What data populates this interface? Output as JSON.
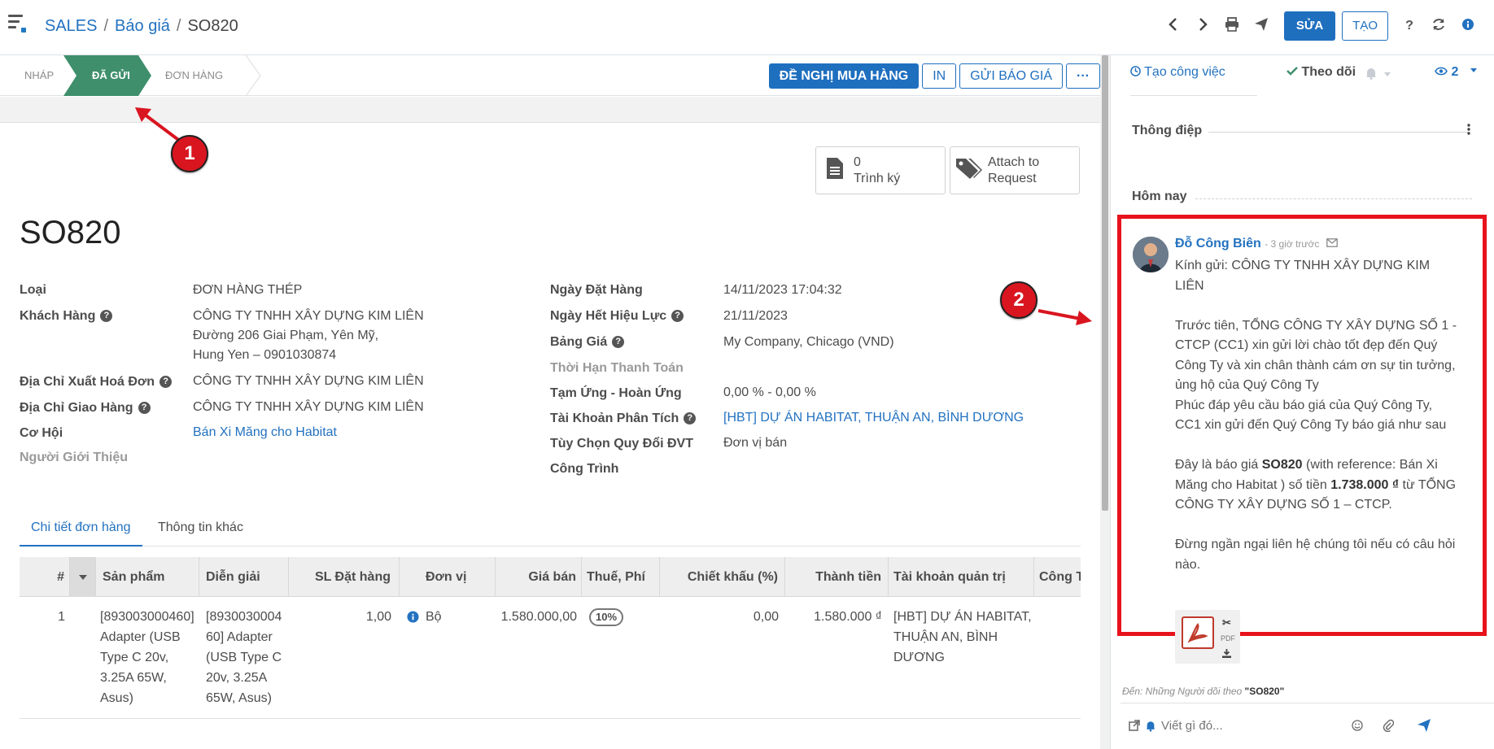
{
  "breadcrumb": {
    "root": "SALES",
    "section": "Báo giá",
    "record": "SO820"
  },
  "toolbar": {
    "edit_label": "SỬA",
    "create_label": "TẠO"
  },
  "status": {
    "stages": [
      "NHÁP",
      "ĐÃ GỬI",
      "ĐƠN HÀNG"
    ],
    "active_stage": "ĐÃ GỬI",
    "actions": {
      "purchase_request": "ĐỀ NGHỊ MUA HÀNG",
      "print": "IN",
      "send_quote": "GỬI BÁO GIÁ"
    }
  },
  "smart_buttons": {
    "sign": {
      "count": "0",
      "label": "Trình ký"
    },
    "attach": {
      "line1": "Attach to",
      "line2": "Request"
    }
  },
  "record": {
    "name": "SO820"
  },
  "fields_left": {
    "type": {
      "label": "Loại",
      "value": "ĐƠN HÀNG THÉP"
    },
    "customer": {
      "label": "Khách Hàng",
      "line1": "CÔNG TY TNHH XÂY DỰNG KIM LIÊN",
      "line2": "Đường 206 Giai Phạm, Yên Mỹ,",
      "line3": "Hung Yen – 0901030874"
    },
    "invoice_addr": {
      "label": "Địa Chỉ Xuất Hoá Đơn",
      "value": "CÔNG TY TNHH XÂY DỰNG KIM LIÊN"
    },
    "delivery_addr": {
      "label": "Địa Chỉ Giao Hàng",
      "value": "CÔNG TY TNHH XÂY DỰNG KIM LIÊN"
    },
    "opportunity": {
      "label": "Cơ Hội",
      "value": "Bán Xi Măng cho Habitat"
    },
    "referrer": {
      "label": "Người Giới Thiệu"
    }
  },
  "fields_right": {
    "order_date": {
      "label": "Ngày Đặt Hàng",
      "value": "14/11/2023 17:04:32"
    },
    "validity": {
      "label": "Ngày Hết Hiệu Lực",
      "value": "21/11/2023"
    },
    "pricelist": {
      "label": "Bảng Giá",
      "value": "My Company, Chicago (VND)"
    },
    "payment_terms": {
      "label": "Thời Hạn Thanh Toán"
    },
    "advance": {
      "label": "Tạm Ứng - Hoàn Ứng",
      "value": "0,00 % - 0,00 %"
    },
    "analytic": {
      "label": "Tài Khoản Phân Tích",
      "value": "[HBT] DỰ ÁN HABITAT, THUẬN AN, BÌNH DƯƠNG"
    },
    "uom_option": {
      "label": "Tùy Chọn Quy Đổi ĐVT",
      "value": "Đơn vị bán"
    },
    "project": {
      "label": "Công Trình"
    }
  },
  "tabs": [
    "Chi tiết đơn hàng",
    "Thông tin khác"
  ],
  "lines": {
    "headers": [
      "#",
      "Sản phẩm",
      "Diễn giải",
      "SL Đặt hàng",
      "Đơn vị",
      "Giá bán",
      "Thuế, Phí",
      "Chiết khấu (%)",
      "Thành tiền",
      "Tài khoản quản trị",
      "Công T"
    ],
    "rows": [
      {
        "no": "1",
        "product": [
          "[893003000460]",
          "Adapter (USB",
          "Type C 20v,",
          "3.25A 65W,",
          "Asus)"
        ],
        "desc": [
          "[8930030004",
          "60] Adapter",
          "(USB Type C",
          "20v, 3.25A",
          "65W, Asus)"
        ],
        "qty": "1,00",
        "uom": "Bộ",
        "price": "1.580.000,00",
        "tax": "10%",
        "discount": "0,00",
        "subtotal": "1.580.000 ₫",
        "analytic": [
          "[HBT] DỰ ÁN HABITAT,",
          "THUẬN AN, BÌNH",
          "DƯƠNG"
        ]
      }
    ]
  },
  "chatter": {
    "schedule_activity": "Tạo công việc",
    "follow": "Theo dõi",
    "followers_count": "2",
    "messages_title": "Thông điệp",
    "today": "Hôm nay",
    "message": {
      "author": "Đỗ Công Biên",
      "time": "- 3 giờ trước",
      "p1": [
        "Kính gửi: CÔNG TY TNHH XÂY DỰNG KIM",
        "LIÊN"
      ],
      "p2": [
        "Trước tiên, TỔNG CÔNG TY XÂY DỰNG SỐ 1 -",
        "CTCP (CC1) xin gửi lời chào tốt đẹp đến Quý",
        "Công Ty và xin chân thành cám ơn sự tin tưởng,",
        "ủng hộ của Quý Công Ty",
        "Phúc đáp yêu cầu báo giá của Quý Công Ty,",
        "CC1 xin gửi đến Quý Công Ty báo giá như sau"
      ],
      "p3_a": "Đây là báo giá ",
      "p3_b": "SO820",
      "p3_c": " (with reference: Bán Xi",
      "p3_d": "Măng cho Habitat ) số tiền ",
      "p3_e": "1.738.000 ₫",
      "p3_f": " từ TỔNG",
      "p3_g": "CÔNG TY XÂY DỰNG SỐ 1 – CTCP.",
      "p4": [
        "Đừng ngần ngại liên hệ chúng tôi nếu có câu hỏi",
        "nào."
      ],
      "attachment_label": "PDF"
    },
    "recipients_prefix": "Đến: Những Người dõi theo ",
    "recipients_record": "\"SO820\"",
    "composer_placeholder": "Viết gì đó..."
  },
  "callouts": [
    "1",
    "2"
  ],
  "colors": {
    "primary": "#1f6fbf",
    "active_stage": "#3f8f6d",
    "highlight": "#e8121c",
    "link": "#2372c0"
  }
}
